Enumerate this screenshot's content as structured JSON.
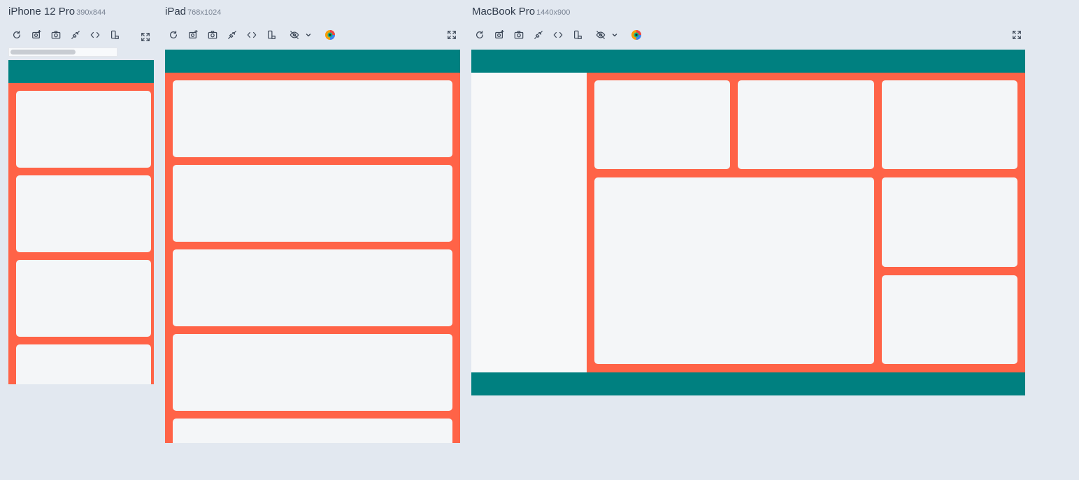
{
  "devices": [
    {
      "name": "iPhone 12 Pro",
      "dims": "390x844"
    },
    {
      "name": "iPad",
      "dims": "768x1024"
    },
    {
      "name": "MacBook Pro",
      "dims": "1440x900"
    }
  ],
  "colors": {
    "background": "#e2e8f0",
    "header": "#008080",
    "main": "#ff6347",
    "card": "#f4f6f8",
    "aside": "#f7f8f9"
  },
  "toolbar_icons": [
    "refresh-icon",
    "screenshot-icon",
    "camera-icon",
    "disconnect-icon",
    "code-icon",
    "rotate-icon",
    "hide-icon",
    "chevron-down-icon",
    "color-picker-icon",
    "fullscreen-icon"
  ]
}
